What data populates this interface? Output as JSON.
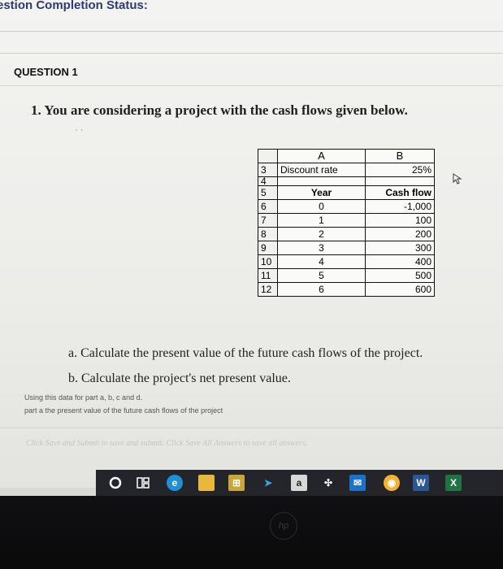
{
  "status_bar": {
    "title": "estion Completion Status:"
  },
  "question": {
    "heading": "QUESTION 1",
    "prompt": "1. You are considering a project with the cash flows given below."
  },
  "spreadsheet": {
    "col_headers": [
      "A",
      "B"
    ],
    "rows": [
      {
        "row": "3",
        "a": "Discount rate",
        "b": "25%"
      },
      {
        "row": "4",
        "a": "",
        "b": ""
      },
      {
        "row": "5",
        "a": "Year",
        "b": "Cash flow"
      },
      {
        "row": "6",
        "a": "0",
        "b": "-1,000"
      },
      {
        "row": "7",
        "a": "1",
        "b": "100"
      },
      {
        "row": "8",
        "a": "2",
        "b": "200"
      },
      {
        "row": "9",
        "a": "3",
        "b": "300"
      },
      {
        "row": "10",
        "a": "4",
        "b": "400"
      },
      {
        "row": "11",
        "a": "5",
        "b": "500"
      },
      {
        "row": "12",
        "a": "6",
        "b": "600"
      }
    ]
  },
  "parts": {
    "a": "a. Calculate the present value of the future cash flows of the project.",
    "b": "b. Calculate the project's net present value."
  },
  "answer_notes": {
    "line1": "Using this data for part a, b, c and d.",
    "line2": "part a the present value of the future cash flows of the project"
  },
  "footer": {
    "instructions": "Click Save and Submit to save and submit. Click Save All Answers to save all answers."
  },
  "taskbar": {
    "icons": [
      "search-icon",
      "task-view-icon",
      "edge-icon",
      "file-explorer-icon",
      "store-icon",
      "arrow-icon",
      "app-a-icon",
      "dropbox-icon",
      "mail-icon",
      "chrome-icon",
      "word-icon",
      "excel-icon"
    ]
  },
  "bezel": {
    "logo": "hp"
  },
  "colors": {
    "status_text": "#2b3b77",
    "taskbar": "#24252a"
  }
}
